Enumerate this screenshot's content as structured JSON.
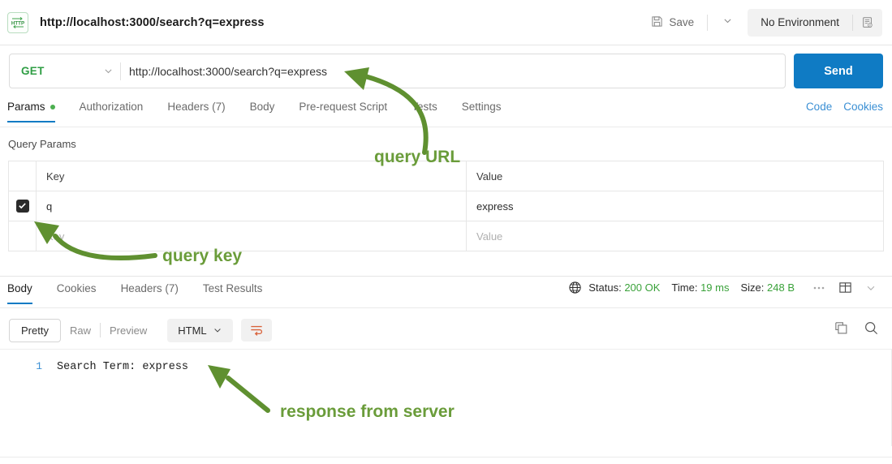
{
  "header": {
    "app_icon": "http-protocol-icon",
    "icon_label": "HTTP",
    "tab_title": "http://localhost:3000/search?q=express",
    "save_label": "Save",
    "save_icon": "floppy-disk-icon",
    "save_chevron_icon": "chevron-down-icon",
    "environment_label": "No Environment",
    "environment_eye_icon": "environment-quick-look-icon"
  },
  "request": {
    "method": "GET",
    "method_chevron_icon": "chevron-down-icon",
    "url": "http://localhost:3000/search?q=express",
    "send_label": "Send",
    "tabs": [
      {
        "label": "Params",
        "active": true,
        "has_dot": true
      },
      {
        "label": "Authorization",
        "active": false,
        "has_dot": false
      },
      {
        "label": "Headers (7)",
        "active": false,
        "has_dot": false
      },
      {
        "label": "Body",
        "active": false,
        "has_dot": false
      },
      {
        "label": "Pre-request Script",
        "active": false,
        "has_dot": false
      },
      {
        "label": "Tests",
        "active": false,
        "has_dot": false
      },
      {
        "label": "Settings",
        "active": false,
        "has_dot": false
      }
    ],
    "code_link": "Code",
    "cookies_link": "Cookies"
  },
  "query_params": {
    "section_label": "Query Params",
    "columns": [
      "Key",
      "Value"
    ],
    "rows": [
      {
        "checked": true,
        "key": "q",
        "value": "express"
      }
    ],
    "empty_row": {
      "key_placeholder": "Key",
      "value_placeholder": "Value"
    }
  },
  "response": {
    "tabs": [
      {
        "label": "Body",
        "active": true
      },
      {
        "label": "Cookies",
        "active": false
      },
      {
        "label": "Headers (7)",
        "active": false
      },
      {
        "label": "Test Results",
        "active": false
      }
    ],
    "globe_icon": "globe-icon",
    "status_label": "Status:",
    "status_value": "200 OK",
    "time_label": "Time:",
    "time_value": "19 ms",
    "size_label": "Size:",
    "size_value": "248 B",
    "more_icon": "ellipsis-icon",
    "layout_icon": "save-response-layout-icon",
    "collapse_icon": "chevron-down-icon",
    "view_pretty": "Pretty",
    "view_raw": "Raw",
    "view_preview": "Preview",
    "format": "HTML",
    "format_chevron_icon": "chevron-down-icon",
    "wrap_icon": "word-wrap-icon",
    "copy_icon": "copy-icon",
    "search_icon": "search-icon",
    "body_lines": [
      {
        "number": "1",
        "text": "Search Term: express"
      }
    ]
  },
  "annotations": [
    {
      "text": "query URL",
      "arrow": "curved-arrow-up-left"
    },
    {
      "text": "query key",
      "arrow": "curved-arrow-up-left"
    },
    {
      "text": "response from server",
      "arrow": "straight-arrow-up-left"
    }
  ],
  "colors": {
    "accent_blue": "#0f7bc4",
    "method_green": "#2f9e44",
    "status_green": "#3aa23a",
    "annotation_green": "#6a9c3a",
    "link_blue": "#3a8fd4",
    "wrap_orange": "#d9623b"
  }
}
